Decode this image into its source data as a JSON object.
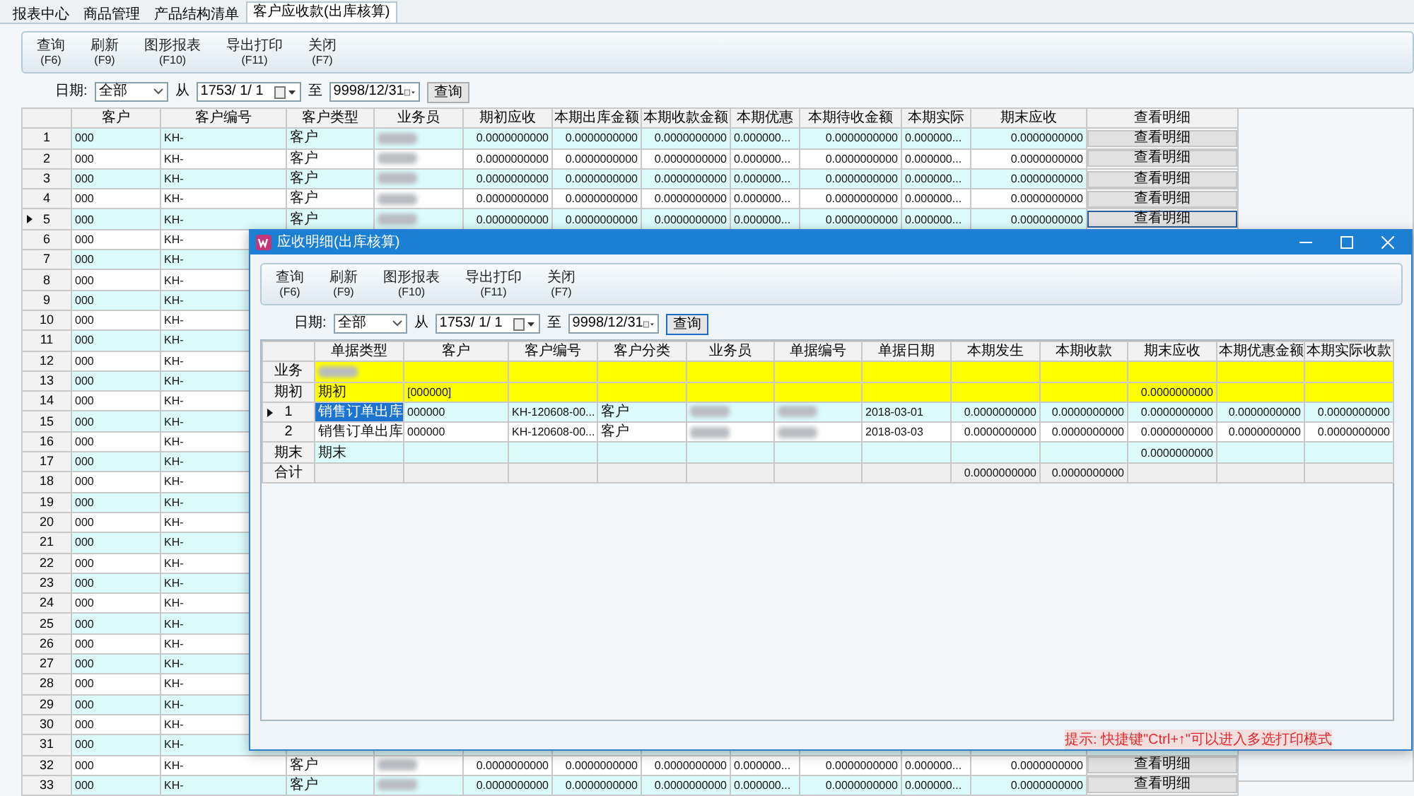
{
  "tabs": [
    {
      "label": "报表中心",
      "selected": false
    },
    {
      "label": "商品管理",
      "selected": false
    },
    {
      "label": "产品结构清单",
      "selected": false
    },
    {
      "label": "客户应收款(出库核算)",
      "selected": true
    }
  ],
  "toolbar": [
    {
      "label": "查询",
      "key": "(F6)"
    },
    {
      "label": "刷新",
      "key": "(F9)"
    },
    {
      "label": "图形报表",
      "key": "(F10)"
    },
    {
      "label": "导出打印",
      "key": "(F11)"
    },
    {
      "label": "关闭",
      "key": "(F7)"
    }
  ],
  "filter": {
    "date_label": "日期:",
    "range": "全部",
    "from_label": "从",
    "from": "1753/ 1/ 1",
    "to_label": "至",
    "to": "9998/12/31",
    "query": "查询"
  },
  "table": {
    "columns": [
      {
        "label": "客户",
        "kind": "text"
      },
      {
        "label": "客户编号",
        "kind": "text"
      },
      {
        "label": "客户类型",
        "kind": "text"
      },
      {
        "label": "业务员",
        "kind": "text"
      },
      {
        "label": "期初应收",
        "kind": "number"
      },
      {
        "label": "本期出库金额",
        "kind": "number"
      },
      {
        "label": "本期收款金额",
        "kind": "number"
      },
      {
        "label": "本期优惠",
        "kind": "text"
      },
      {
        "label": "本期待收金额",
        "kind": "number"
      },
      {
        "label": "本期实际",
        "kind": "text"
      },
      {
        "label": "期末应收",
        "kind": "number"
      },
      {
        "label": "查看明细",
        "kind": "button"
      }
    ],
    "rows": [
      {
        "num": "1",
        "selected": false,
        "cells": [
          "000",
          "KH-",
          "客户",
          {
            "blurred": true
          },
          "0.0000000000",
          "0.0000000000",
          "0.0000000000",
          "0.000000...",
          "0.0000000000",
          "0.000000...",
          "0.0000000000",
          "查看明细"
        ]
      },
      {
        "num": "2",
        "selected": false,
        "cells": [
          "000",
          "KH-",
          "客户",
          {
            "blurred": true
          },
          "0.0000000000",
          "0.0000000000",
          "0.0000000000",
          "0.000000...",
          "0.0000000000",
          "0.000000...",
          "0.0000000000",
          "查看明细"
        ]
      },
      {
        "num": "3",
        "selected": false,
        "cells": [
          "000",
          "KH-",
          "客户",
          {
            "blurred": true
          },
          "0.0000000000",
          "0.0000000000",
          "0.0000000000",
          "0.000000...",
          "0.0000000000",
          "0.000000...",
          "0.0000000000",
          "查看明细"
        ]
      },
      {
        "num": "4",
        "selected": false,
        "cells": [
          "000",
          "KH-",
          "客户",
          {
            "blurred": true
          },
          "0.0000000000",
          "0.0000000000",
          "0.0000000000",
          "0.000000...",
          "0.0000000000",
          "0.000000...",
          "0.0000000000",
          "查看明细"
        ]
      },
      {
        "num": "5",
        "selected": true,
        "cells": [
          "000",
          "KH-",
          "客户",
          {
            "blurred": true
          },
          "0.0000000000",
          "0.0000000000",
          "0.0000000000",
          "0.000000...",
          "0.0000000000",
          "0.000000...",
          "0.0000000000",
          "查看明细"
        ]
      },
      {
        "num": "6",
        "selected": false,
        "cells": [
          "000",
          "KH-"
        ]
      },
      {
        "num": "7",
        "selected": false,
        "cells": [
          "000",
          "KH-"
        ]
      },
      {
        "num": "8",
        "selected": false,
        "cells": [
          "000",
          "KH-"
        ]
      },
      {
        "num": "9",
        "selected": false,
        "cells": [
          "000",
          "KH-"
        ]
      },
      {
        "num": "10",
        "selected": false,
        "cells": [
          "000",
          "KH-"
        ]
      },
      {
        "num": "11",
        "selected": false,
        "cells": [
          "000",
          "KH-"
        ]
      },
      {
        "num": "12",
        "selected": false,
        "cells": [
          "000",
          "KH-"
        ]
      },
      {
        "num": "13",
        "selected": false,
        "cells": [
          "000",
          "KH-"
        ]
      },
      {
        "num": "14",
        "selected": false,
        "cells": [
          "000",
          "KH-"
        ]
      },
      {
        "num": "15",
        "selected": false,
        "cells": [
          "000",
          "KH-"
        ]
      },
      {
        "num": "16",
        "selected": false,
        "cells": [
          "000",
          "KH-"
        ]
      },
      {
        "num": "17",
        "selected": false,
        "cells": [
          "000",
          "KH-"
        ]
      },
      {
        "num": "18",
        "selected": false,
        "cells": [
          "000",
          "KH-"
        ]
      },
      {
        "num": "19",
        "selected": false,
        "cells": [
          "000",
          "KH-"
        ]
      },
      {
        "num": "20",
        "selected": false,
        "cells": [
          "000",
          "KH-"
        ]
      },
      {
        "num": "21",
        "selected": false,
        "cells": [
          "000",
          "KH-"
        ]
      },
      {
        "num": "22",
        "selected": false,
        "cells": [
          "000",
          "KH-"
        ]
      },
      {
        "num": "23",
        "selected": false,
        "cells": [
          "000",
          "KH-"
        ]
      },
      {
        "num": "24",
        "selected": false,
        "cells": [
          "000",
          "KH-"
        ]
      },
      {
        "num": "25",
        "selected": false,
        "cells": [
          "000",
          "KH-"
        ]
      },
      {
        "num": "26",
        "selected": false,
        "cells": [
          "000",
          "KH-"
        ]
      },
      {
        "num": "27",
        "selected": false,
        "cells": [
          "000",
          "KH-"
        ]
      },
      {
        "num": "28",
        "selected": false,
        "cells": [
          "000",
          "KH-"
        ]
      },
      {
        "num": "29",
        "selected": false,
        "cells": [
          "000",
          "KH-"
        ]
      },
      {
        "num": "30",
        "selected": false,
        "cells": [
          "000",
          "KH-"
        ]
      },
      {
        "num": "31",
        "selected": false,
        "cells": [
          "000",
          "KH-"
        ]
      },
      {
        "num": "32",
        "selected": false,
        "cells": [
          "000",
          "KH-",
          "客户",
          {
            "blurred": true
          },
          "0.0000000000",
          "0.0000000000",
          "0.0000000000",
          "0.000000...",
          "0.0000000000",
          "0.000000...",
          "0.0000000000",
          "查看明细"
        ]
      },
      {
        "num": "33",
        "selected": false,
        "cells": [
          "000",
          "KH-",
          "客户",
          {
            "blurred": true
          },
          "0.0000000000",
          "0.0000000000",
          "0.0000000000",
          "0.000000...",
          "0.0000000000",
          "0.000000...",
          "0.0000000000",
          "查看明细"
        ]
      }
    ]
  },
  "dialog": {
    "title": "应收明细(出库核算)",
    "toolbar": [
      {
        "label": "查询",
        "key": "(F6)"
      },
      {
        "label": "刷新",
        "key": "(F9)"
      },
      {
        "label": "图形报表",
        "key": "(F10)"
      },
      {
        "label": "导出打印",
        "key": "(F11)"
      },
      {
        "label": "关闭",
        "key": "(F7)"
      }
    ],
    "filter": {
      "date_label": "日期:",
      "range": "全部",
      "from_label": "从",
      "from": "1753/ 1/ 1",
      "to_label": "至",
      "to": "9998/12/31",
      "query": "查询"
    },
    "table": {
      "columns": [
        {
          "label": "单据类型",
          "kind": "text"
        },
        {
          "label": "客户",
          "kind": "text"
        },
        {
          "label": "客户编号",
          "kind": "text"
        },
        {
          "label": "客户分类",
          "kind": "text"
        },
        {
          "label": "业务员",
          "kind": "text"
        },
        {
          "label": "单据编号",
          "kind": "text"
        },
        {
          "label": "单据日期",
          "kind": "text"
        },
        {
          "label": "本期发生",
          "kind": "number"
        },
        {
          "label": "本期收款",
          "kind": "number"
        },
        {
          "label": "期末应收",
          "kind": "number"
        },
        {
          "label": "本期优惠金额",
          "kind": "number"
        },
        {
          "label": "本期实际收款",
          "kind": "number"
        }
      ],
      "rows": [
        {
          "label": "业务",
          "kind": "group",
          "selected": false,
          "cells": [
            {
              "blurred": true
            },
            null,
            null,
            null,
            null,
            null,
            null,
            null,
            null,
            null,
            null,
            null
          ]
        },
        {
          "label": "期初",
          "kind": "group",
          "selected": false,
          "cells": [
            "期初",
            "[000000]",
            null,
            null,
            null,
            null,
            null,
            null,
            null,
            "0.0000000000",
            null,
            null
          ]
        },
        {
          "label": "1",
          "kind": "data",
          "selected": true,
          "cells": [
            "销售订单出库",
            "000000",
            "KH-120608-00...",
            "客户",
            {
              "blurred": true
            },
            {
              "blurred": true
            },
            "2018-03-01",
            "0.0000000000",
            "0.0000000000",
            "0.0000000000",
            "0.0000000000",
            "0.0000000000"
          ]
        },
        {
          "label": "2",
          "kind": "data",
          "selected": false,
          "cells": [
            "销售订单出库",
            "000000",
            "KH-120608-00...",
            "客户",
            {
              "blurred": true
            },
            {
              "blurred": true
            },
            "2018-03-03",
            "0.0000000000",
            "0.0000000000",
            "0.0000000000",
            "0.0000000000",
            "0.0000000000"
          ]
        },
        {
          "label": "期末",
          "kind": "closing",
          "selected": false,
          "cells": [
            "期末",
            null,
            null,
            null,
            null,
            null,
            null,
            null,
            null,
            "0.0000000000",
            null,
            null
          ]
        },
        {
          "label": "合计",
          "kind": "total",
          "selected": false,
          "cells": [
            null,
            null,
            null,
            null,
            null,
            null,
            null,
            "0.0000000000",
            "0.0000000000",
            null,
            null,
            null
          ]
        }
      ]
    },
    "hint": "提示: 快捷键\"Ctrl+↑\"可以进入多选打印模式"
  }
}
